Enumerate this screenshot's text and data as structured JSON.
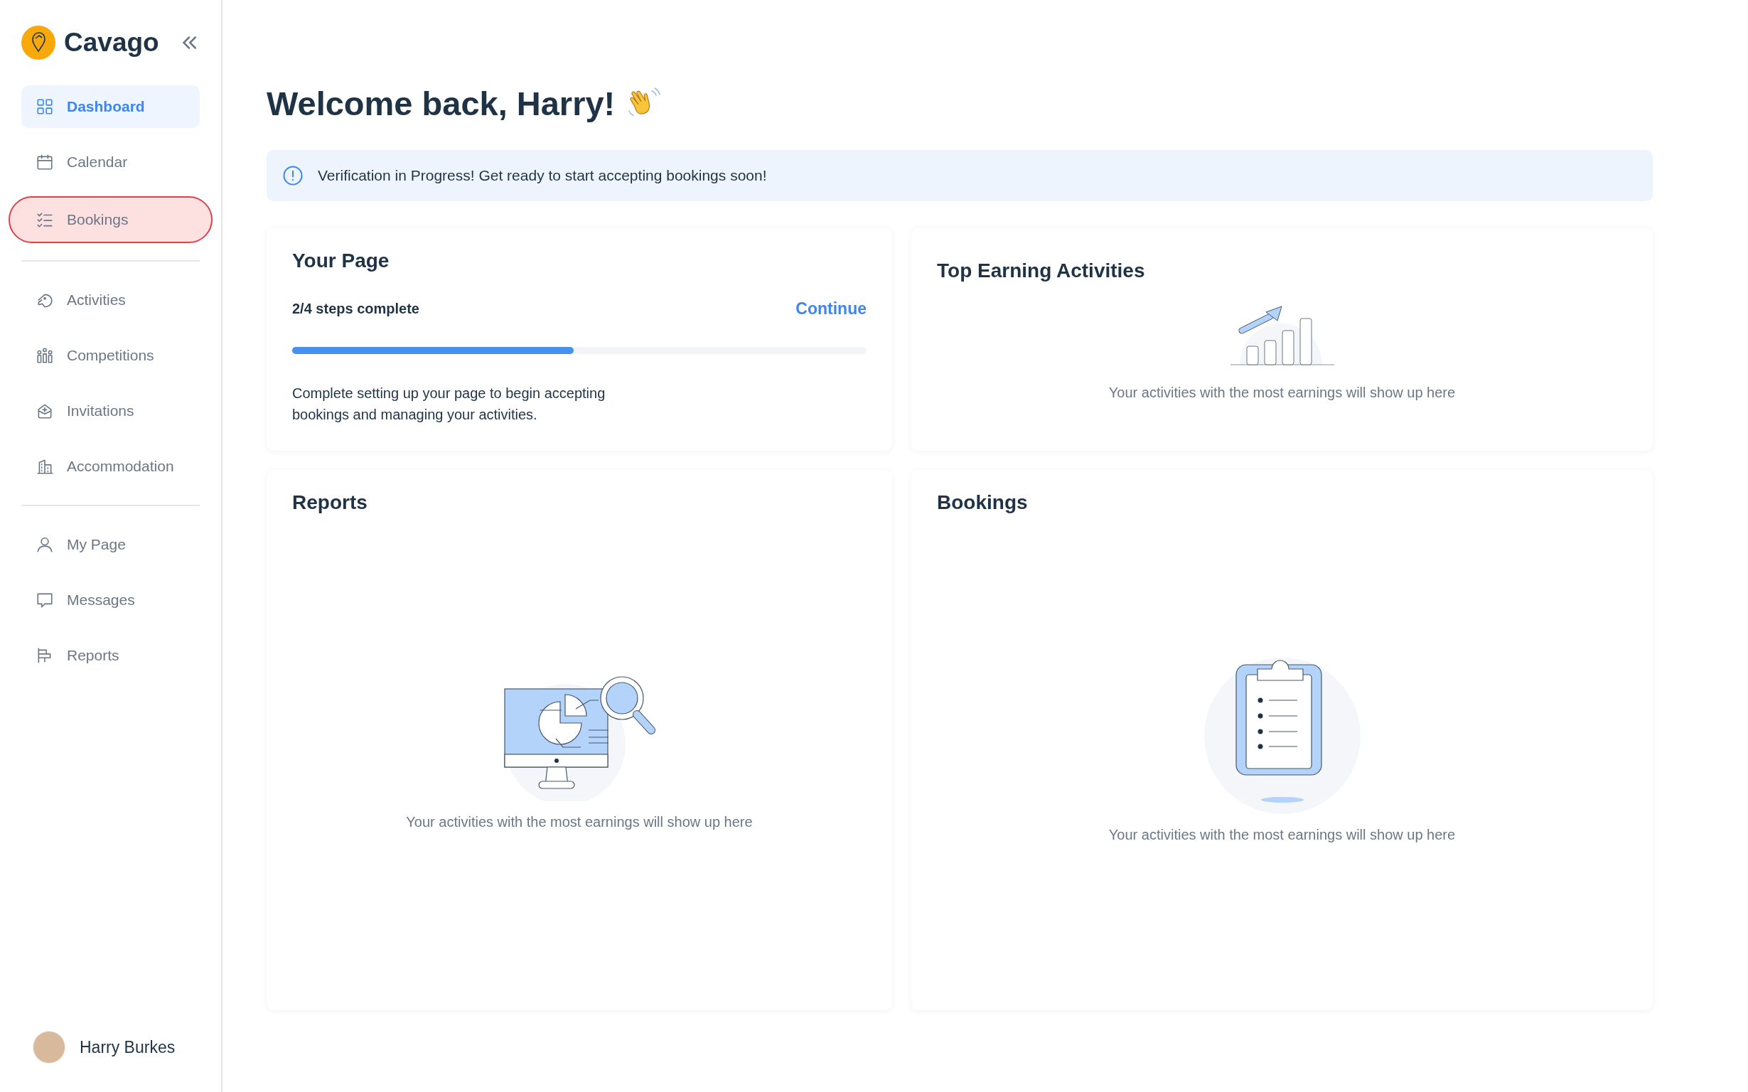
{
  "brand": {
    "name": "Cavago"
  },
  "sidebar": {
    "groups": [
      [
        {
          "label": "Dashboard",
          "selected": true,
          "highlighted": false
        },
        {
          "label": "Calendar",
          "selected": false,
          "highlighted": false
        },
        {
          "label": "Bookings",
          "selected": false,
          "highlighted": true
        }
      ],
      [
        {
          "label": "Activities",
          "selected": false,
          "highlighted": false
        },
        {
          "label": "Competitions",
          "selected": false,
          "highlighted": false
        },
        {
          "label": "Invitations",
          "selected": false,
          "highlighted": false
        },
        {
          "label": "Accommodation",
          "selected": false,
          "highlighted": false
        }
      ],
      [
        {
          "label": "My Page",
          "selected": false,
          "highlighted": false
        },
        {
          "label": "Messages",
          "selected": false,
          "highlighted": false
        },
        {
          "label": "Reports",
          "selected": false,
          "highlighted": false
        }
      ]
    ],
    "user": {
      "name": "Harry Burkes"
    }
  },
  "heading": "Welcome back, Harry!",
  "banner": {
    "text": "Verification in Progress! Get ready to start accepting bookings soon!"
  },
  "your_page": {
    "title": "Your Page",
    "steps": "2/4 steps complete",
    "action": "Continue",
    "level": 0.49,
    "description": "Complete setting up your page to begin accepting bookings and managing your activities."
  },
  "top_earning": {
    "title": "Top Earning Activities",
    "empty_text": "Your activities with the most earnings will show up here"
  },
  "reports": {
    "title": "Reports",
    "empty_text": "Your activities with the most earnings will show up here"
  },
  "bookings": {
    "title": "Bookings",
    "empty_text": "Your activities with the most earnings will show up here"
  }
}
